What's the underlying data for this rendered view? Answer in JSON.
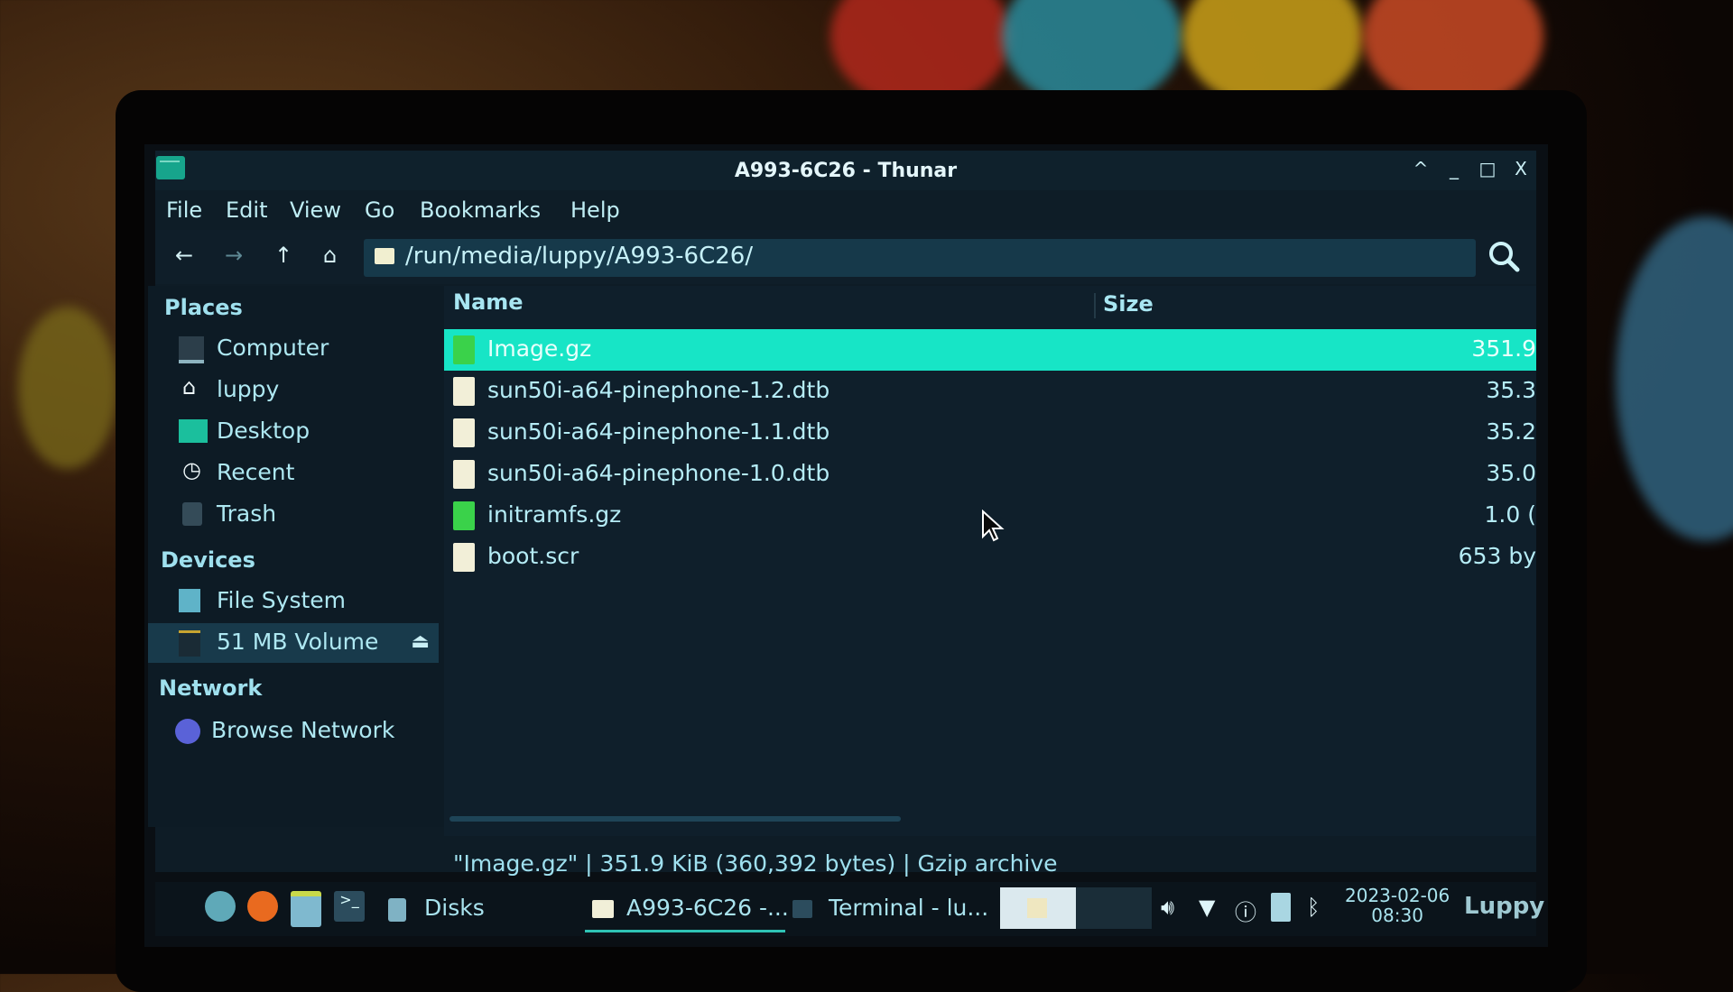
{
  "window": {
    "title": "A993-6C26 - Thunar",
    "controls": {
      "shade": "^",
      "minimize": "_",
      "maximize": "□",
      "close": "X"
    }
  },
  "menubar": {
    "items": [
      "File",
      "Edit",
      "View",
      "Go",
      "Bookmarks",
      "Help"
    ]
  },
  "toolbar": {
    "back_icon": "←",
    "forward_icon": "→",
    "up_icon": "↑",
    "home_icon": "⌂",
    "path": "/run/media/luppy/A993-6C26/"
  },
  "sidebar": {
    "sections": [
      {
        "heading": "Places",
        "items": [
          {
            "label": "Computer",
            "icon": "computer-icon"
          },
          {
            "label": "luppy",
            "icon": "home-icon"
          },
          {
            "label": "Desktop",
            "icon": "desktop-icon"
          },
          {
            "label": "Recent",
            "icon": "clock-icon"
          },
          {
            "label": "Trash",
            "icon": "trash-icon"
          }
        ]
      },
      {
        "heading": "Devices",
        "items": [
          {
            "label": "File System",
            "icon": "drive-icon"
          },
          {
            "label": "51 MB Volume",
            "icon": "sd-card-icon",
            "selected": true,
            "eject": "⏏"
          }
        ]
      },
      {
        "heading": "Network",
        "items": [
          {
            "label": "Browse Network",
            "icon": "globe-icon"
          }
        ]
      }
    ]
  },
  "filelist": {
    "columns": {
      "name": "Name",
      "size": "Size"
    },
    "rows": [
      {
        "name": "Image.gz",
        "size": "351.9",
        "type": "archive",
        "selected": true
      },
      {
        "name": "sun50i-a64-pinephone-1.2.dtb",
        "size": "35.3",
        "type": "text"
      },
      {
        "name": "sun50i-a64-pinephone-1.1.dtb",
        "size": "35.2",
        "type": "text"
      },
      {
        "name": "sun50i-a64-pinephone-1.0.dtb",
        "size": "35.0",
        "type": "text"
      },
      {
        "name": "initramfs.gz",
        "size": "1.0 (",
        "type": "archive"
      },
      {
        "name": "boot.scr",
        "size": "653 by",
        "type": "binary"
      }
    ]
  },
  "statusbar": {
    "text": "\"Image.gz\"  |  351.9 KiB (360,392 bytes)  |  Gzip archive"
  },
  "taskbar": {
    "launchers": [
      "app-menu",
      "firefox",
      "file-manager",
      "terminal"
    ],
    "tasks": [
      {
        "label": "Disks",
        "icon": "disks-icon"
      },
      {
        "label": "A993-6C26 -...",
        "icon": "folder-icon",
        "active": true
      },
      {
        "label": "Terminal - lu...",
        "icon": "terminal-icon"
      }
    ],
    "clock_date": "2023-02-06",
    "clock_time": "08:30",
    "user": "Luppy"
  },
  "colors": {
    "accent": "#17e5c6",
    "window_bg": "#0e1c26",
    "text": "#b5ecf6",
    "pathbar_bg": "#16394a"
  }
}
